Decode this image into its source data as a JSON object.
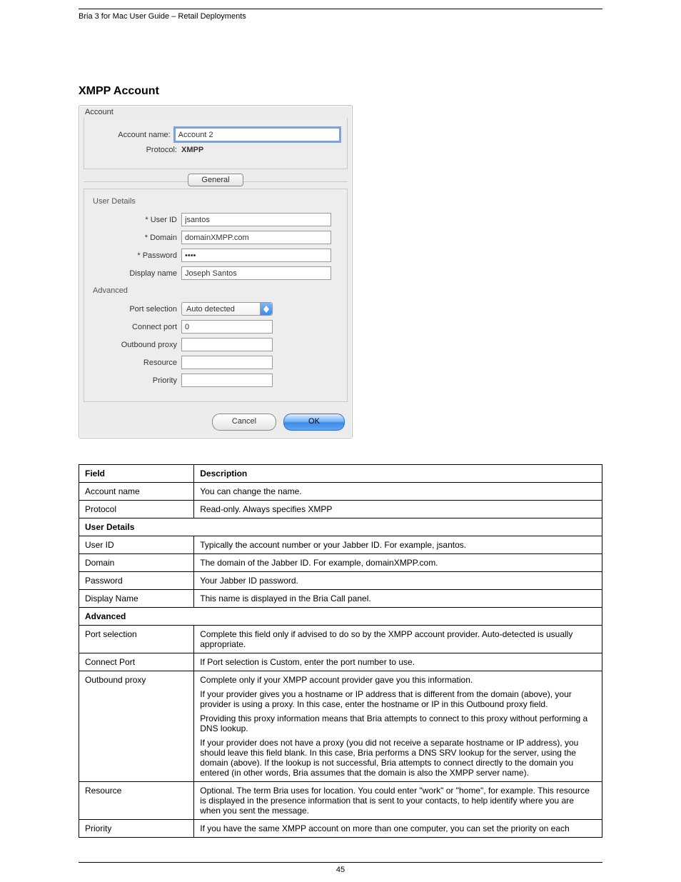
{
  "header": {
    "left": "Bria 3 for Mac User Guide – Retail Deployments",
    "right": ""
  },
  "page_title": "XMPP Account",
  "dialog": {
    "section_account": "Account",
    "account_name_label": "Account name:",
    "account_name_value": "Account 2",
    "protocol_label": "Protocol:",
    "protocol_value": "XMPP",
    "tab_general": "General",
    "user_details": "User Details",
    "user_id_label": "* User ID",
    "user_id_value": "jsantos",
    "domain_label": "* Domain",
    "domain_value": "domainXMPP.com",
    "password_label": "* Password",
    "password_value": "••••",
    "display_name_label": "Display name",
    "display_name_value": "Joseph Santos",
    "advanced": "Advanced",
    "port_selection_label": "Port selection",
    "port_selection_value": "Auto detected",
    "connect_port_label": "Connect port",
    "connect_port_value": "0",
    "outbound_proxy_label": "Outbound proxy",
    "outbound_proxy_value": "",
    "resource_label": "Resource",
    "resource_value": "",
    "priority_label": "Priority",
    "priority_value": "",
    "cancel": "Cancel",
    "ok": "OK"
  },
  "table": {
    "hdr_field": "Field",
    "hdr_desc": "Description",
    "r1_field": "Account name",
    "r1_desc": "You can change the name.",
    "r2_field": "Protocol",
    "r2_desc": "Read-only. Always specifies XMPP",
    "sec_user": "User Details",
    "r3_field": "User ID",
    "r3_desc": "Typically the account number or your Jabber ID. For example, jsantos.",
    "r4_field": "Domain",
    "r4_desc": "The domain of the Jabber ID. For example, domainXMPP.com.",
    "r5_field": "Password",
    "r5_desc": "Your Jabber ID password.",
    "r6_field": "Display Name",
    "r6_desc": "This name is displayed in the Bria Call panel.",
    "sec_advanced": "Advanced",
    "r7_field": "Port selection",
    "r7_desc": "Complete this field only if advised to do so by the XMPP account provider. Auto-detected is usually appropriate.",
    "r8_field": "Connect Port",
    "r8_desc": "If Port selection is Custom, enter the port number to use.",
    "r9_field": "Outbound proxy",
    "r9_desc_1": "Complete only if your XMPP account provider gave you this information.",
    "r9_desc_2": "If your provider gives you a hostname or IP address that is different from the domain (above), your provider is using a proxy. In this case, enter the hostname or IP in this Outbound proxy field.",
    "r9_desc_3": "Providing this proxy information means that Bria attempts to connect to this proxy without performing a DNS lookup.",
    "r9_desc_4": "If your provider does not have a proxy (you did not receive a separate hostname or IP address), you should leave this field blank. In this case, Bria performs a DNS SRV lookup for the server, using the domain (above). If the lookup is not successful, Bria attempts to connect directly to the domain you entered (in other words, Bria assumes that the domain is also the XMPP server name).",
    "r10_field": "Resource",
    "r10_desc": "Optional. The term Bria uses for location. You could enter \"work\" or \"home\", for example. This resource is displayed in the presence information that is sent to your contacts, to help identify where you are when you sent the message.",
    "r11_field": "Priority",
    "r11_desc": "If you have the same XMPP account on more than one computer, you can set the priority on each"
  },
  "footer": {
    "page_num": "45"
  }
}
